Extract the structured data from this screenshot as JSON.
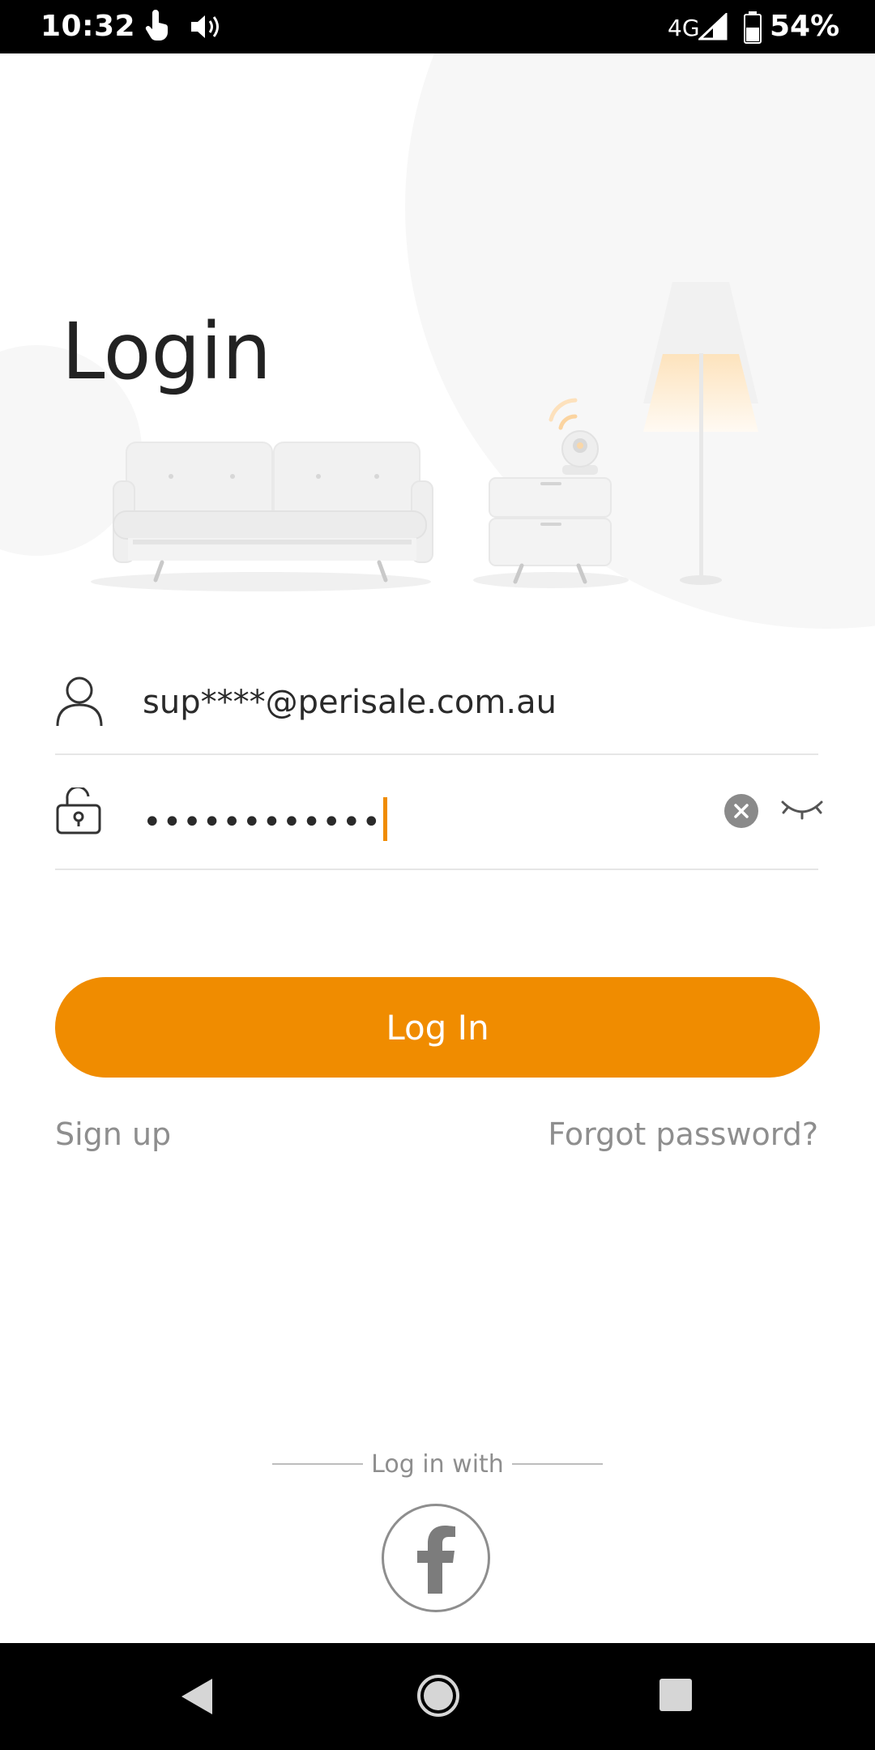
{
  "status_bar": {
    "time": "10:32",
    "network": "4G",
    "battery": "54%",
    "icons": [
      "touch-icon",
      "volume-icon",
      "signal-icon",
      "battery-icon"
    ]
  },
  "screen": {
    "title": "Login"
  },
  "form": {
    "email": {
      "value": "sup****@perisale.com.au"
    },
    "password": {
      "value": "••••••••••••"
    }
  },
  "actions": {
    "login_label": "Log In",
    "signup_label": "Sign up",
    "forgot_label": "Forgot password?"
  },
  "social": {
    "label": "Log in with",
    "providers": [
      "facebook-icon"
    ]
  },
  "colors": {
    "accent": "#f08c00",
    "text": "#222222",
    "muted": "#8e8e8e",
    "divider": "#e6e6e6"
  }
}
